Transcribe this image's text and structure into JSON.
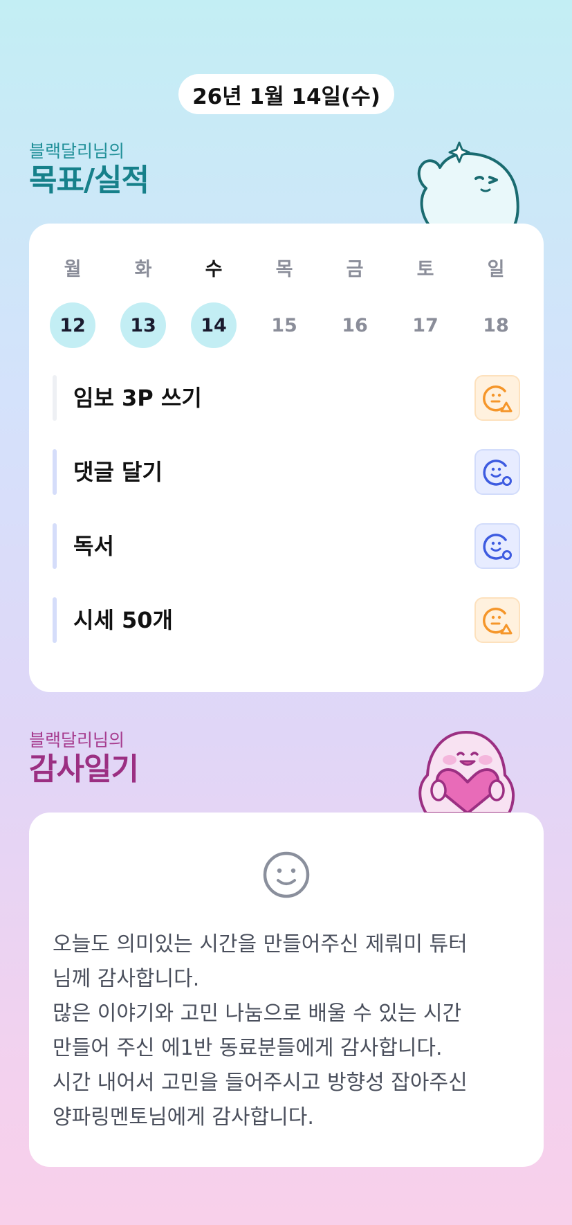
{
  "date_label": "26년 1월 14일(수)",
  "goals_section": {
    "subtitle": "블랙달리님의",
    "title": "목표/실적"
  },
  "week": [
    {
      "day": "월",
      "date": "12",
      "done": true,
      "today": false
    },
    {
      "day": "화",
      "date": "13",
      "done": true,
      "today": false
    },
    {
      "day": "수",
      "date": "14",
      "done": true,
      "today": true
    },
    {
      "day": "목",
      "date": "15",
      "done": false,
      "today": false
    },
    {
      "day": "금",
      "date": "16",
      "done": false,
      "today": false
    },
    {
      "day": "토",
      "date": "17",
      "done": false,
      "today": false
    },
    {
      "day": "일",
      "date": "18",
      "done": false,
      "today": false
    }
  ],
  "goals": [
    {
      "text": "임보 3P 쓰기",
      "status": "partial",
      "status_icon": "smile-triangle-icon",
      "bar_color": "#eef0f4"
    },
    {
      "text": "댓글 달기",
      "status": "achieved",
      "status_icon": "smile-circle-icon",
      "bar_color": "#d5ddfa"
    },
    {
      "text": "독서",
      "status": "achieved",
      "status_icon": "smile-circle-icon",
      "bar_color": "#d5ddfa"
    },
    {
      "text": "시세 50개",
      "status": "partial",
      "status_icon": "smile-triangle-icon",
      "bar_color": "#d5ddfa"
    }
  ],
  "diary_section": {
    "subtitle": "블랙달리님의",
    "title": "감사일기"
  },
  "diary": {
    "icon": "smiley-face-icon",
    "text": "오늘도 의미있는 시간을 만들어주신 제뤄미 튜터\n님께 감사합니다.\n많은 이야기와 고민 나눔으로 배울 수 있는 시간\n만들어 주신 에1반 동료분들에게 감사합니다.\n시간 내어서 고민을 들어주시고 방향성 잡아주신\n양파링멘토님에게 감사합니다."
  },
  "colors": {
    "teal_title": "#16808a",
    "pink_title": "#9b2f82",
    "done_circle": "#c3eef4",
    "status_orange": "#f5962a",
    "status_blue": "#3d5be0"
  }
}
